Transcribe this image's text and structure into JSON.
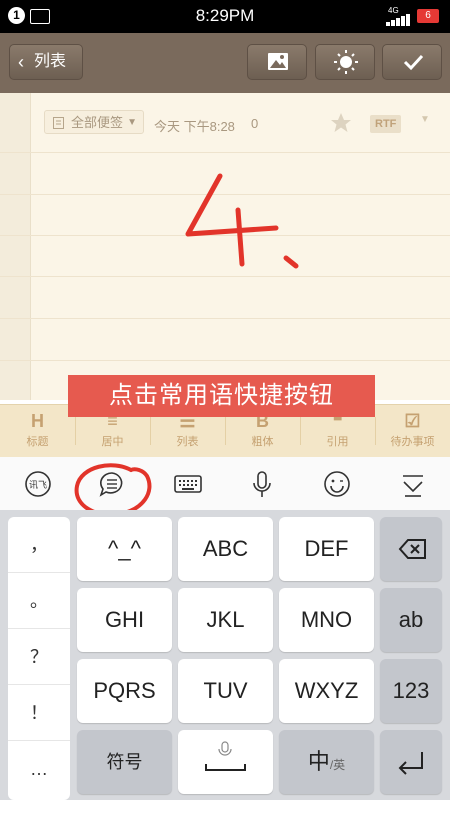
{
  "status_bar": {
    "sim": "1",
    "time": "8:29PM",
    "network": "4G",
    "battery": "6"
  },
  "toolbar": {
    "back_label": "列表"
  },
  "note": {
    "folder": "全部便签",
    "timestamp": "今天 下午8:28",
    "count": "0",
    "format_badge": "RTF",
    "handwriting": "4、"
  },
  "tooltip": "点击常用语快捷按钮",
  "format_bar": [
    {
      "icon": "H",
      "label": "标题"
    },
    {
      "icon": "≡",
      "label": "居中"
    },
    {
      "icon": "☰",
      "label": "列表"
    },
    {
      "icon": "B",
      "label": "粗体"
    },
    {
      "icon": "❝",
      "label": "引用"
    },
    {
      "icon": "☑",
      "label": "待办事项"
    }
  ],
  "ime_bar": {
    "handwrite_label": "讯飞"
  },
  "keyboard": {
    "symbols": [
      "，",
      "。",
      "？",
      "！",
      "…"
    ],
    "row1": [
      "^_^",
      "ABC",
      "DEF"
    ],
    "row2": [
      "GHI",
      "JKL",
      "MNO",
      "ab"
    ],
    "row3": [
      "PQRS",
      "TUV",
      "WXYZ",
      "123"
    ],
    "row4": {
      "symbols": "符号",
      "lang_main": "中",
      "lang_sub": "/英"
    }
  },
  "colors": {
    "toolbar": "#7a6a5c",
    "tooltip": "#e65a4f",
    "accent": "#e2342a",
    "paper": "#fbf5e7"
  }
}
